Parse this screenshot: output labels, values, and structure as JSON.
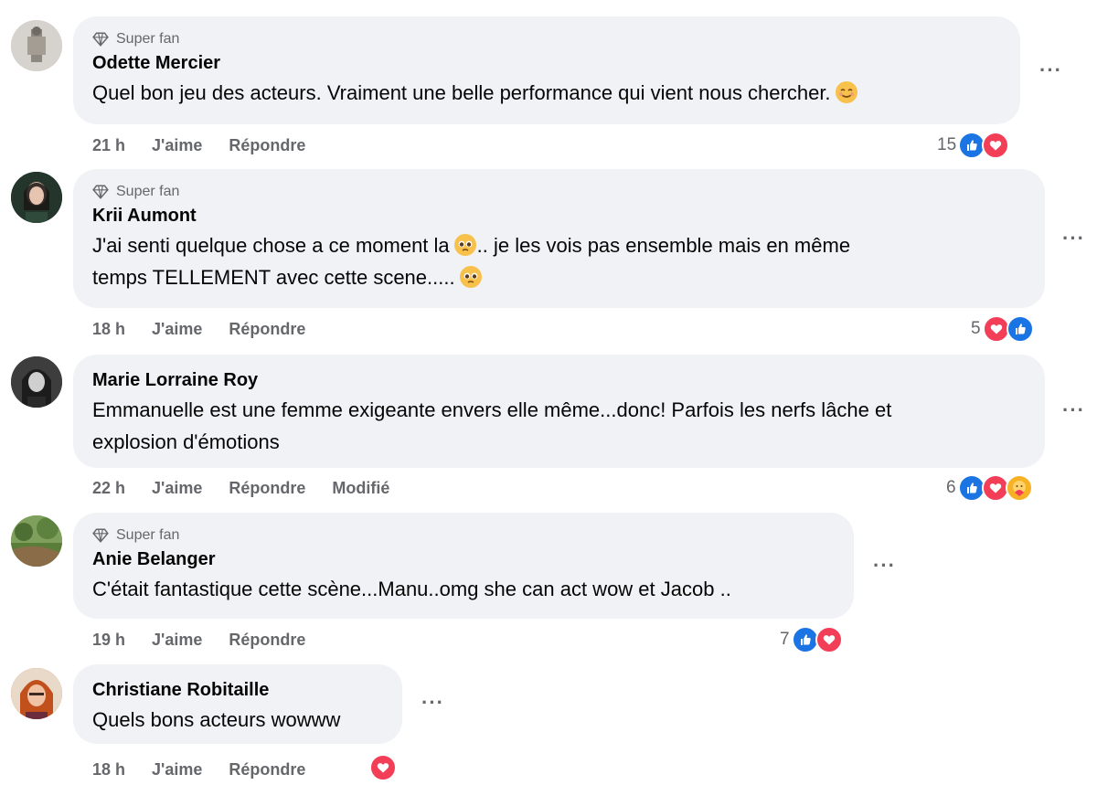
{
  "comments": [
    {
      "badge": "Super fan",
      "author": "Odette Mercier",
      "text": "Quel bon jeu des acteurs. Vraiment une belle performance qui vient nous chercher.",
      "time": "21 h",
      "like_label": "J'aime",
      "reply_label": "Répondre",
      "reaction_count": "15",
      "reactions": [
        "like-icon",
        "love-icon"
      ],
      "emoji": "smiling-face-emoji"
    },
    {
      "badge": "Super fan",
      "author": "Krii Aumont",
      "text_line1": "J'ai senti quelque chose a ce moment la",
      "text_line1_end": ".. je les vois pas ensemble mais en même",
      "text_line2": "temps TELLEMENT avec cette scene.....",
      "time": "18 h",
      "like_label": "J'aime",
      "reply_label": "Répondre",
      "reaction_count": "5",
      "reactions": [
        "love-icon",
        "like-icon"
      ],
      "emoji": "pleading-face-emoji"
    },
    {
      "author": "Marie Lorraine Roy",
      "text_line1": "Emmanuelle est une femme exigeante envers elle même...donc! Parfois les nerfs lâche et",
      "text_line2": "explosion d'émotions",
      "time": "22 h",
      "like_label": "J'aime",
      "reply_label": "Répondre",
      "edited_label": "Modifié",
      "reaction_count": "6",
      "reactions": [
        "like-icon",
        "love-icon",
        "care-icon"
      ]
    },
    {
      "badge": "Super fan",
      "author": "Anie Belanger",
      "text": "C'était fantastique cette scène...Manu..omg she can act wow et Jacob ..",
      "time": "19 h",
      "like_label": "J'aime",
      "reply_label": "Répondre",
      "reaction_count": "7",
      "reactions": [
        "like-icon",
        "love-icon"
      ]
    },
    {
      "author": "Christiane Robitaille",
      "text": "Quels bons acteurs wowww",
      "time": "18 h",
      "like_label": "J'aime",
      "reply_label": "Répondre",
      "reactions": [
        "love-icon"
      ]
    }
  ],
  "more_label": "···",
  "colors": {
    "bubble": "#f0f2f5",
    "secondary_text": "#65676b",
    "like_blue": "#1b74e4",
    "love_red": "#f33e58",
    "care_yellow": "#f7b125"
  }
}
